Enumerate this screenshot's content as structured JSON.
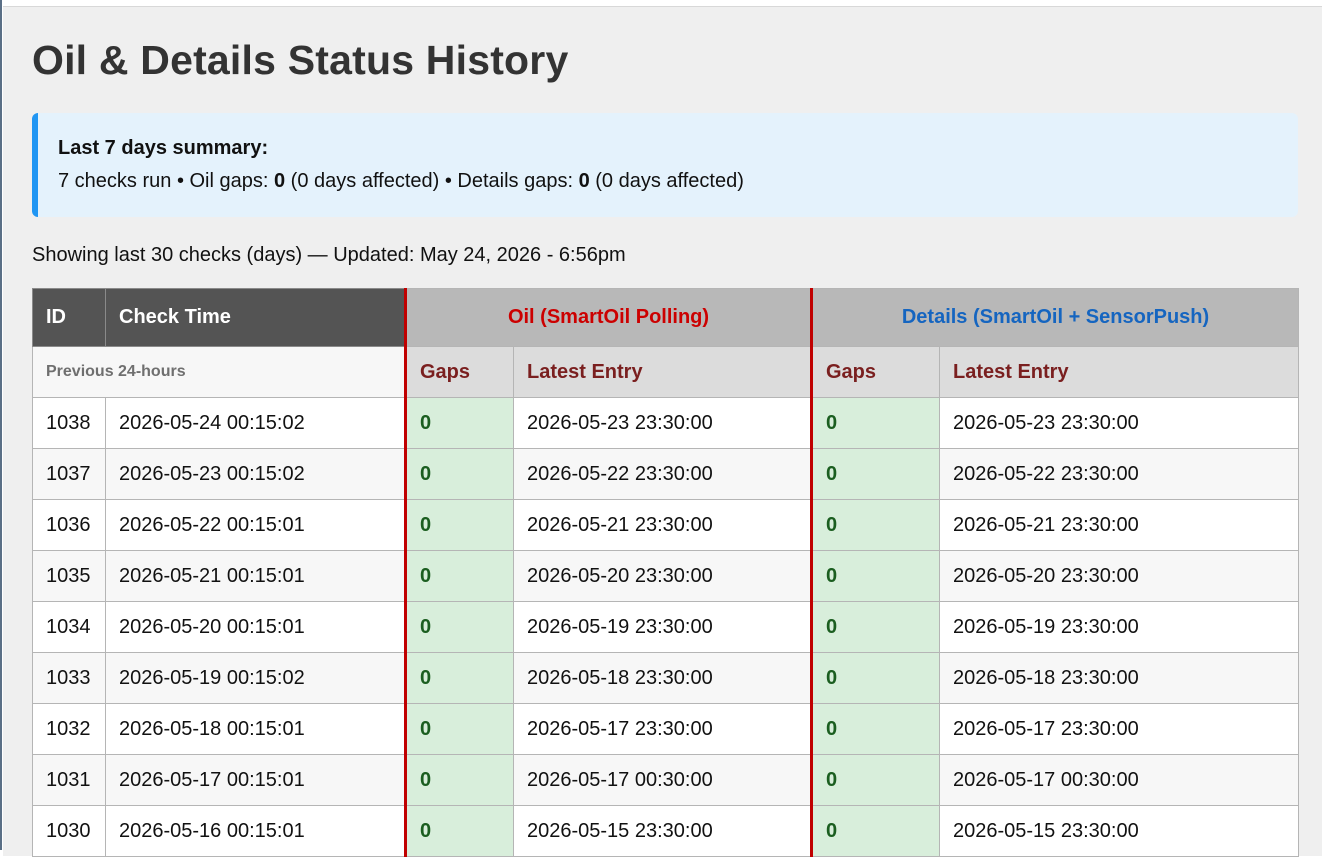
{
  "page": {
    "title": "Oil & Details Status History"
  },
  "summary": {
    "title": "Last 7 days summary:",
    "checks_text": "7 checks run • Oil gaps: ",
    "oil_gaps": "0",
    "oil_affected": " (0 days affected) • Details gaps: ",
    "details_gaps": "0",
    "details_affected": " (0 days affected)"
  },
  "showing_text": "Showing last 30 checks (days) — Updated: May 24, 2026 - 6:56pm",
  "table": {
    "headers": {
      "id": "ID",
      "check_time": "Check Time",
      "oil_group": "Oil (SmartOil Polling)",
      "details_group": "Details (SmartOil + SensorPush)",
      "previous_24h": "Previous 24-hours",
      "oil_gaps": "Gaps",
      "oil_latest": "Latest Entry",
      "details_gaps": "Gaps",
      "details_latest": "Latest Entry"
    },
    "rows": [
      {
        "id": "1038",
        "check_time": "2026-05-24 00:15:02",
        "oil_gaps": "0",
        "oil_latest": "2026-05-23 23:30:00",
        "details_gaps": "0",
        "details_latest": "2026-05-23 23:30:00"
      },
      {
        "id": "1037",
        "check_time": "2026-05-23 00:15:02",
        "oil_gaps": "0",
        "oil_latest": "2026-05-22 23:30:00",
        "details_gaps": "0",
        "details_latest": "2026-05-22 23:30:00"
      },
      {
        "id": "1036",
        "check_time": "2026-05-22 00:15:01",
        "oil_gaps": "0",
        "oil_latest": "2026-05-21 23:30:00",
        "details_gaps": "0",
        "details_latest": "2026-05-21 23:30:00"
      },
      {
        "id": "1035",
        "check_time": "2026-05-21 00:15:01",
        "oil_gaps": "0",
        "oil_latest": "2026-05-20 23:30:00",
        "details_gaps": "0",
        "details_latest": "2026-05-20 23:30:00"
      },
      {
        "id": "1034",
        "check_time": "2026-05-20 00:15:01",
        "oil_gaps": "0",
        "oil_latest": "2026-05-19 23:30:00",
        "details_gaps": "0",
        "details_latest": "2026-05-19 23:30:00"
      },
      {
        "id": "1033",
        "check_time": "2026-05-19 00:15:02",
        "oil_gaps": "0",
        "oil_latest": "2026-05-18 23:30:00",
        "details_gaps": "0",
        "details_latest": "2026-05-18 23:30:00"
      },
      {
        "id": "1032",
        "check_time": "2026-05-18 00:15:01",
        "oil_gaps": "0",
        "oil_latest": "2026-05-17 23:30:00",
        "details_gaps": "0",
        "details_latest": "2026-05-17 23:30:00"
      },
      {
        "id": "1031",
        "check_time": "2026-05-17 00:15:01",
        "oil_gaps": "0",
        "oil_latest": "2026-05-17 00:30:00",
        "details_gaps": "0",
        "details_latest": "2026-05-17 00:30:00"
      },
      {
        "id": "1030",
        "check_time": "2026-05-16 00:15:01",
        "oil_gaps": "0",
        "oil_latest": "2026-05-15 23:30:00",
        "details_gaps": "0",
        "details_latest": "2026-05-15 23:30:00"
      }
    ]
  },
  "colors": {
    "summary_accent": "#2196f3",
    "oil_header": "#cc0000",
    "details_header": "#1565c0",
    "gap_ok_bg": "#d8eedb",
    "gap_ok_text": "#1b5e20",
    "section_divider": "#c00000"
  }
}
